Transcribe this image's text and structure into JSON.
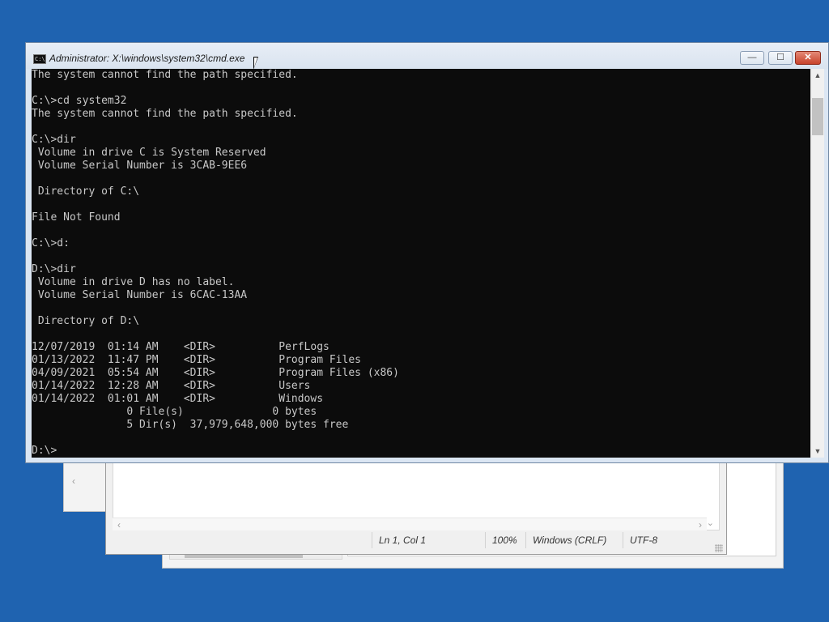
{
  "cmd": {
    "title": "Administrator: X:\\windows\\system32\\cmd.exe",
    "icon_text": "C:\\",
    "buttons": {
      "min": "—",
      "max": "☐",
      "close": "✕"
    },
    "lines": [
      "The system cannot find the path specified.",
      "",
      "C:\\>cd system32",
      "The system cannot find the path specified.",
      "",
      "C:\\>dir",
      " Volume in drive C is System Reserved",
      " Volume Serial Number is 3CAB-9EE6",
      "",
      " Directory of C:\\",
      "",
      "File Not Found",
      "",
      "C:\\>d:",
      "",
      "D:\\>dir",
      " Volume in drive D has no label.",
      " Volume Serial Number is 6CAC-13AA",
      "",
      " Directory of D:\\",
      "",
      "12/07/2019  01:14 AM    <DIR>          PerfLogs",
      "01/13/2022  11:47 PM    <DIR>          Program Files",
      "04/09/2021  05:54 AM    <DIR>          Program Files (x86)",
      "01/14/2022  12:28 AM    <DIR>          Users",
      "01/14/2022  01:01 AM    <DIR>          Windows",
      "               0 File(s)              0 bytes",
      "               5 Dir(s)  37,979,648,000 bytes free",
      "",
      "D:\\>"
    ]
  },
  "notepad": {
    "status": {
      "position": "Ln 1, Col 1",
      "zoom": "100%",
      "line_ending": "Windows (CRLF)",
      "encoding": "UTF-8"
    }
  },
  "icons": {
    "scroll_up": "▲",
    "scroll_down": "▼",
    "left": "‹",
    "right": "›",
    "chev_down": "⌄"
  },
  "colors": {
    "desktop": "#1f63b0",
    "console_bg": "#0c0c0c",
    "console_fg": "#c8c8c8"
  }
}
